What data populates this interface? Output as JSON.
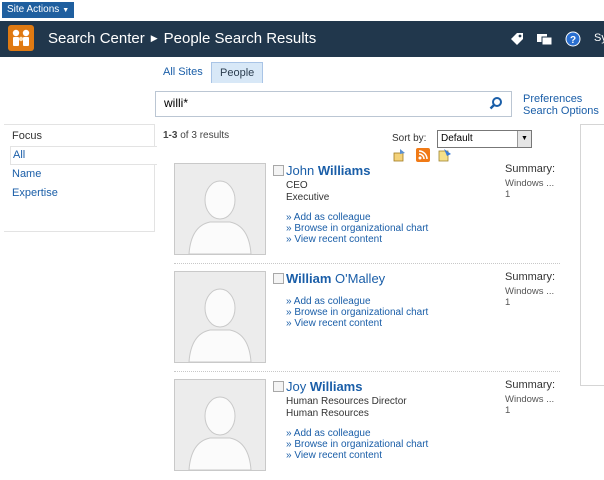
{
  "ribbon": {
    "site_actions": "Site Actions"
  },
  "header": {
    "breadcrumb": [
      "Search Center",
      "People Search Results"
    ],
    "user_partial": "Sy"
  },
  "scope_tabs": [
    {
      "label": "All Sites",
      "selected": false
    },
    {
      "label": "People",
      "selected": true
    }
  ],
  "search": {
    "query": "willi*"
  },
  "search_links": {
    "preferences": "Preferences",
    "options": "Search Options"
  },
  "refinement": {
    "heading": "Focus",
    "items": [
      {
        "label": "All",
        "selected": true
      },
      {
        "label": "Name",
        "selected": false
      },
      {
        "label": "Expertise",
        "selected": false
      }
    ]
  },
  "results_info": {
    "range": "1-3",
    "suffix": "of 3 results"
  },
  "sort": {
    "label": "Sort by:",
    "value": "Default"
  },
  "results": [
    {
      "name_pre": "John ",
      "name_hit": "Williams",
      "name_post": "",
      "line1": "CEO",
      "line2": "Executive",
      "actions": [
        "» Add as colleague",
        "» Browse in organizational chart",
        "» View recent content"
      ],
      "summary": "Summary:",
      "summary_l1": "Windows ...",
      "summary_l2": "1"
    },
    {
      "name_pre": "",
      "name_hit": "William",
      "name_post": " O'Malley",
      "line1": "",
      "line2": "",
      "actions": [
        "» Add as colleague",
        "» Browse in organizational chart",
        "» View recent content"
      ],
      "summary": "Summary:",
      "summary_l1": "Windows ...",
      "summary_l2": "1"
    },
    {
      "name_pre": "Joy ",
      "name_hit": "Williams",
      "name_post": "",
      "line1": "Human Resources Director",
      "line2": "Human Resources",
      "actions": [
        "» Add as colleague",
        "» Browse in organizational chart",
        "» View recent content"
      ],
      "summary": "Summary:",
      "summary_l1": "Windows ...",
      "summary_l2": "1"
    }
  ],
  "colors": {
    "header_bg": "#21374c",
    "link": "#1a5ea8",
    "accent": "#e07a12"
  }
}
